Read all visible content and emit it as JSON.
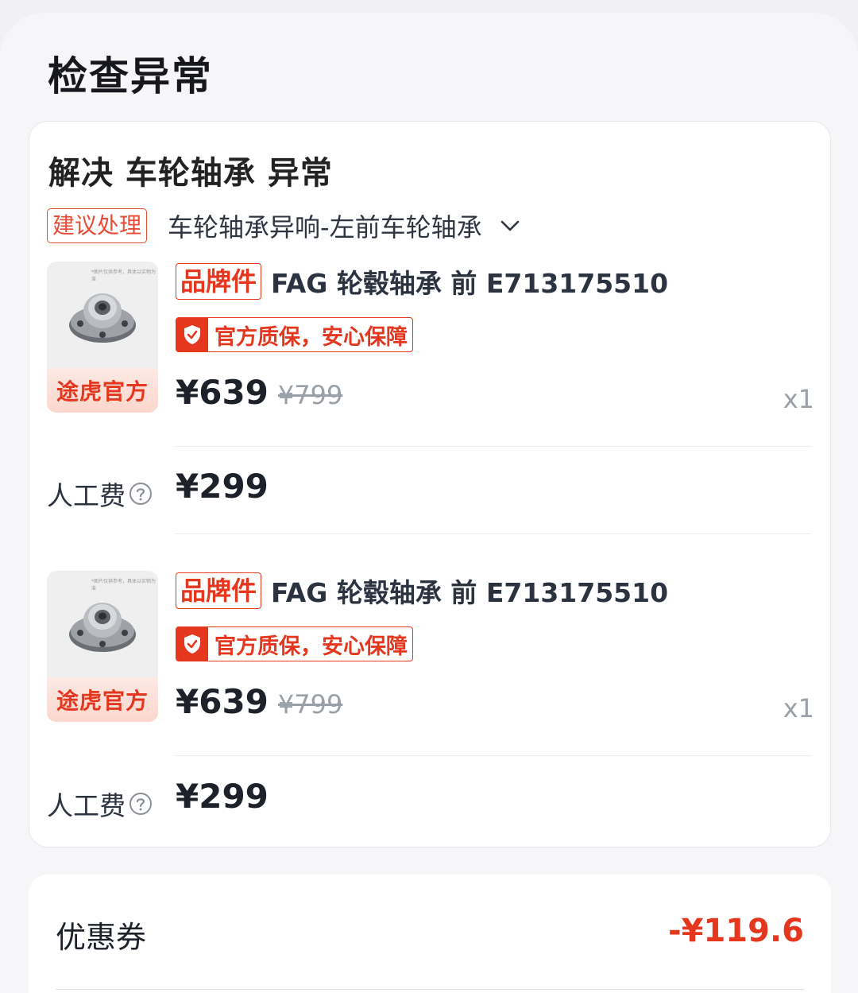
{
  "page": {
    "title": "检查异常"
  },
  "card": {
    "heading": "解决 车轮轴承 异常",
    "advice_tag": "建议处理",
    "issue_select": "车轮轴承异响-左前车轮轴承"
  },
  "items": [
    {
      "thumb_band": "途虎官方",
      "thumb_note": "*图片仅供参考，具体以实物为准",
      "brand_tag": "品牌件",
      "name": "FAG 轮毂轴承 前 E713175510",
      "warranty": "官方质保，安心保障",
      "price": "¥639",
      "original_price": "¥799",
      "quantity": "x1",
      "labor_label": "人工费",
      "labor_price": "¥299"
    },
    {
      "thumb_band": "途虎官方",
      "thumb_note": "*图片仅供参考，具体以实物为准",
      "brand_tag": "品牌件",
      "name": "FAG 轮毂轴承 前 E713175510",
      "warranty": "官方质保，安心保障",
      "price": "¥639",
      "original_price": "¥799",
      "quantity": "x1",
      "labor_label": "人工费",
      "labor_price": "¥299"
    }
  ],
  "coupon": {
    "label": "优惠券",
    "value": "-¥119.6"
  },
  "colors": {
    "accent_red": "#e5361e",
    "text_dark": "#1d2129",
    "muted": "#9aa0a8"
  },
  "icons": {
    "dropdown": "chevron-down-icon",
    "warranty": "shield-check-icon",
    "help": "question-circle-icon"
  }
}
